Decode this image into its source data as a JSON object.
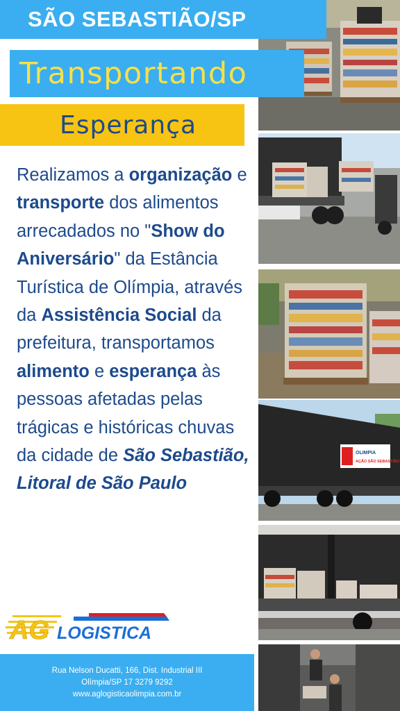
{
  "header": {
    "title": "SÃO SEBASTIÃO/SP",
    "subtitle_1": "Transportando",
    "subtitle_2": "Esperança"
  },
  "body": {
    "t1": "Realizamos a ",
    "b1": "organização",
    "t2": " e ",
    "b2": "transporte",
    "t3": " dos alimentos arrecadados no \"",
    "b3": "Show do Aniversário",
    "t4": "\" da Estância Turística de Olímpia, através da ",
    "b4": "Assistência Social",
    "t5": " da prefeitura, transportamos ",
    "b5": "alimento",
    "t6": " e ",
    "b6": "esperança",
    "t7": " às pessoas afetadas pelas trágicas e históricas chuvas da cidade de ",
    "b7": "São Sebastião, Litoral de São Paulo"
  },
  "logo": {
    "text_ag": "AG",
    "text_logistica": "LOGISTICA",
    "colors": {
      "yellow": "#f7c413",
      "blue": "#1a6fd6",
      "red": "#e02020"
    }
  },
  "footer": {
    "address": "Rua Nelson Ducatti, 166, Dist. Industrial III",
    "city_phone": "Olímpia/SP 17 3279 9292",
    "website": "www.aglogisticaolimpia.com.br"
  },
  "truck_banner": {
    "line1": "OLIMPIA",
    "line2": "AÇÃO SÃO SEBASTIÃO"
  },
  "colors": {
    "primary_blue": "#3aaef0",
    "dark_blue": "#1d4a8c",
    "yellow": "#f7c413",
    "light_yellow": "#f7e048"
  }
}
